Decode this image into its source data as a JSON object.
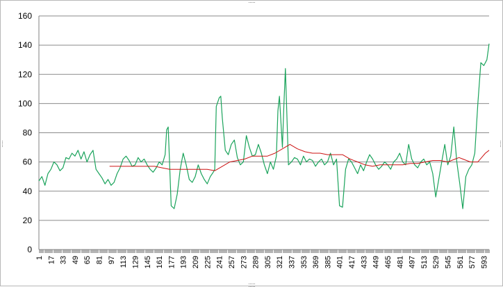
{
  "chart_data": {
    "type": "line",
    "title": "",
    "xlabel": "",
    "ylabel": "",
    "ylim": [
      0,
      160
    ],
    "y_ticks": [
      0,
      20,
      40,
      60,
      80,
      100,
      120,
      140,
      160
    ],
    "xlim": [
      1,
      600
    ],
    "x_tick_labels": [
      "1",
      "17",
      "33",
      "49",
      "65",
      "81",
      "97",
      "113",
      "129",
      "145",
      "161",
      "177",
      "193",
      "209",
      "225",
      "241",
      "257",
      "273",
      "289",
      "305",
      "321",
      "337",
      "353",
      "369",
      "385",
      "401",
      "417",
      "433",
      "449",
      "465",
      "481",
      "497",
      "513",
      "529",
      "545",
      "561",
      "577",
      "593"
    ],
    "grid": true,
    "legend": "none",
    "series": [
      {
        "color": "#1aa35b",
        "x": [
          1,
          5,
          9,
          13,
          17,
          21,
          25,
          29,
          33,
          37,
          41,
          45,
          49,
          53,
          57,
          61,
          65,
          69,
          73,
          77,
          81,
          85,
          89,
          93,
          97,
          101,
          105,
          109,
          113,
          117,
          121,
          125,
          129,
          133,
          137,
          141,
          145,
          149,
          153,
          157,
          161,
          165,
          169,
          171,
          173,
          177,
          181,
          185,
          189,
          193,
          197,
          201,
          205,
          209,
          213,
          217,
          221,
          225,
          229,
          233,
          235,
          237,
          241,
          243,
          245,
          249,
          253,
          257,
          261,
          265,
          269,
          273,
          277,
          281,
          285,
          289,
          293,
          297,
          301,
          305,
          309,
          313,
          317,
          319,
          321,
          325,
          327,
          329,
          333,
          337,
          341,
          345,
          349,
          353,
          357,
          361,
          365,
          369,
          373,
          377,
          381,
          385,
          389,
          393,
          397,
          401,
          405,
          409,
          413,
          417,
          421,
          425,
          429,
          433,
          437,
          441,
          445,
          449,
          453,
          457,
          461,
          465,
          469,
          473,
          477,
          481,
          485,
          489,
          493,
          497,
          501,
          505,
          509,
          513,
          517,
          521,
          525,
          529,
          533,
          537,
          541,
          545,
          549,
          553,
          557,
          561,
          565,
          569,
          573,
          577,
          581,
          585,
          589,
          593,
          597,
          600
        ],
        "values": [
          47,
          50,
          44,
          52,
          55,
          60,
          58,
          54,
          56,
          63,
          62,
          66,
          64,
          68,
          62,
          67,
          60,
          65,
          68,
          55,
          52,
          49,
          45,
          48,
          44,
          46,
          52,
          56,
          62,
          64,
          61,
          57,
          58,
          63,
          60,
          62,
          58,
          55,
          53,
          56,
          60,
          58,
          65,
          82,
          84,
          30,
          28,
          38,
          55,
          66,
          58,
          48,
          46,
          50,
          58,
          52,
          48,
          45,
          50,
          53,
          55,
          98,
          104,
          105,
          90,
          68,
          65,
          72,
          75,
          63,
          58,
          60,
          78,
          70,
          64,
          65,
          72,
          66,
          58,
          52,
          60,
          55,
          64,
          95,
          105,
          70,
          100,
          124,
          58,
          60,
          63,
          62,
          58,
          64,
          60,
          62,
          61,
          57,
          60,
          62,
          58,
          60,
          66,
          58,
          62,
          30,
          29,
          55,
          62,
          60,
          56,
          52,
          58,
          54,
          60,
          65,
          62,
          58,
          55,
          57,
          60,
          58,
          55,
          60,
          62,
          66,
          60,
          58,
          72,
          62,
          58,
          56,
          60,
          62,
          58,
          60,
          52,
          36,
          48,
          60,
          72,
          58,
          64,
          84,
          60,
          45,
          28,
          50,
          55,
          58,
          66,
          100,
          128,
          126,
          130,
          141
        ]
      },
      {
        "color": "#cc1111",
        "x": [
          95,
          110,
          125,
          140,
          155,
          165,
          175,
          185,
          195,
          205,
          215,
          225,
          235,
          245,
          255,
          265,
          275,
          285,
          295,
          305,
          315,
          325,
          335,
          345,
          355,
          365,
          375,
          385,
          395,
          405,
          415,
          425,
          435,
          445,
          455,
          465,
          475,
          485,
          495,
          505,
          515,
          525,
          535,
          545,
          555,
          560,
          565,
          575,
          585,
          590,
          595,
          600
        ],
        "values": [
          57,
          57,
          57,
          57,
          57,
          56,
          55,
          55,
          55,
          55,
          55,
          55,
          54,
          57,
          60,
          61,
          62,
          64,
          64,
          64,
          66,
          69,
          72,
          69,
          67,
          66,
          66,
          65,
          65,
          65,
          62,
          60,
          58,
          57,
          58,
          58,
          58,
          58,
          59,
          59,
          60,
          61,
          61,
          60,
          62,
          63,
          62,
          60,
          60,
          63,
          66,
          68
        ]
      }
    ]
  }
}
